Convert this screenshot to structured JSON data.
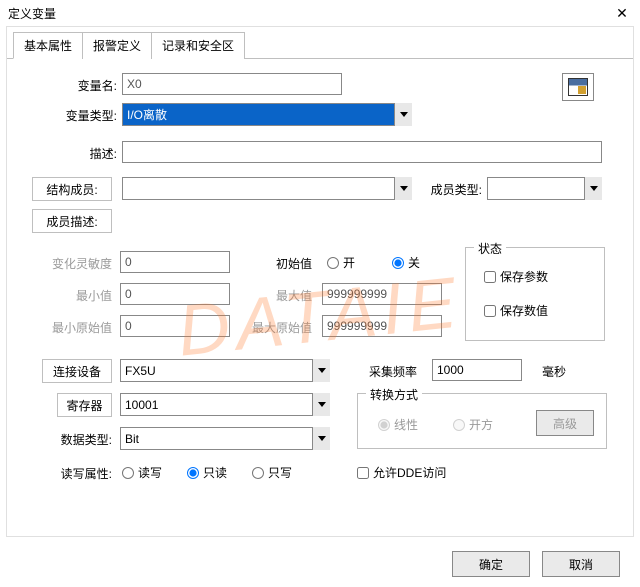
{
  "window": {
    "title": "定义变量",
    "close": "✕"
  },
  "tabs": [
    "基本属性",
    "报警定义",
    "记录和安全区"
  ],
  "labels": {
    "var_name": "变量名:",
    "var_type": "变量类型:",
    "desc": "描述:",
    "struct_member": "结构成员:",
    "member_type": "成员类型:",
    "member_desc": "成员描述:",
    "sensitivity": "变化灵敏度",
    "min": "最小值",
    "min_raw": "最小原始值",
    "init": "初始值",
    "max": "最大值",
    "max_raw": "最大原始值",
    "device": "连接设备",
    "register": "寄存器",
    "datatype": "数据类型:",
    "rw": "读写属性:",
    "freq": "采集频率",
    "freq_unit": "毫秒",
    "status": "状态",
    "convert": "转换方式"
  },
  "values": {
    "var_name": "X0",
    "var_type": "I/O离散",
    "desc": "",
    "struct_member": "",
    "member_type": "",
    "member_desc": "",
    "sensitivity": "0",
    "min": "0",
    "min_raw": "0",
    "max": "999999999",
    "max_raw": "999999999",
    "device": "FX5U",
    "register": "10001",
    "datatype": "Bit",
    "freq": "1000"
  },
  "radios": {
    "init_on": "开",
    "init_off": "关",
    "rw_rw": "读写",
    "rw_r": "只读",
    "rw_w": "只写",
    "conv_linear": "线性",
    "conv_sqrt": "开方"
  },
  "checks": {
    "save_param": "保存参数",
    "save_value": "保存数值",
    "dde": "允许DDE访问"
  },
  "buttons": {
    "advanced": "高级",
    "ok": "确定",
    "cancel": "取消"
  },
  "watermark": "DATAIE"
}
